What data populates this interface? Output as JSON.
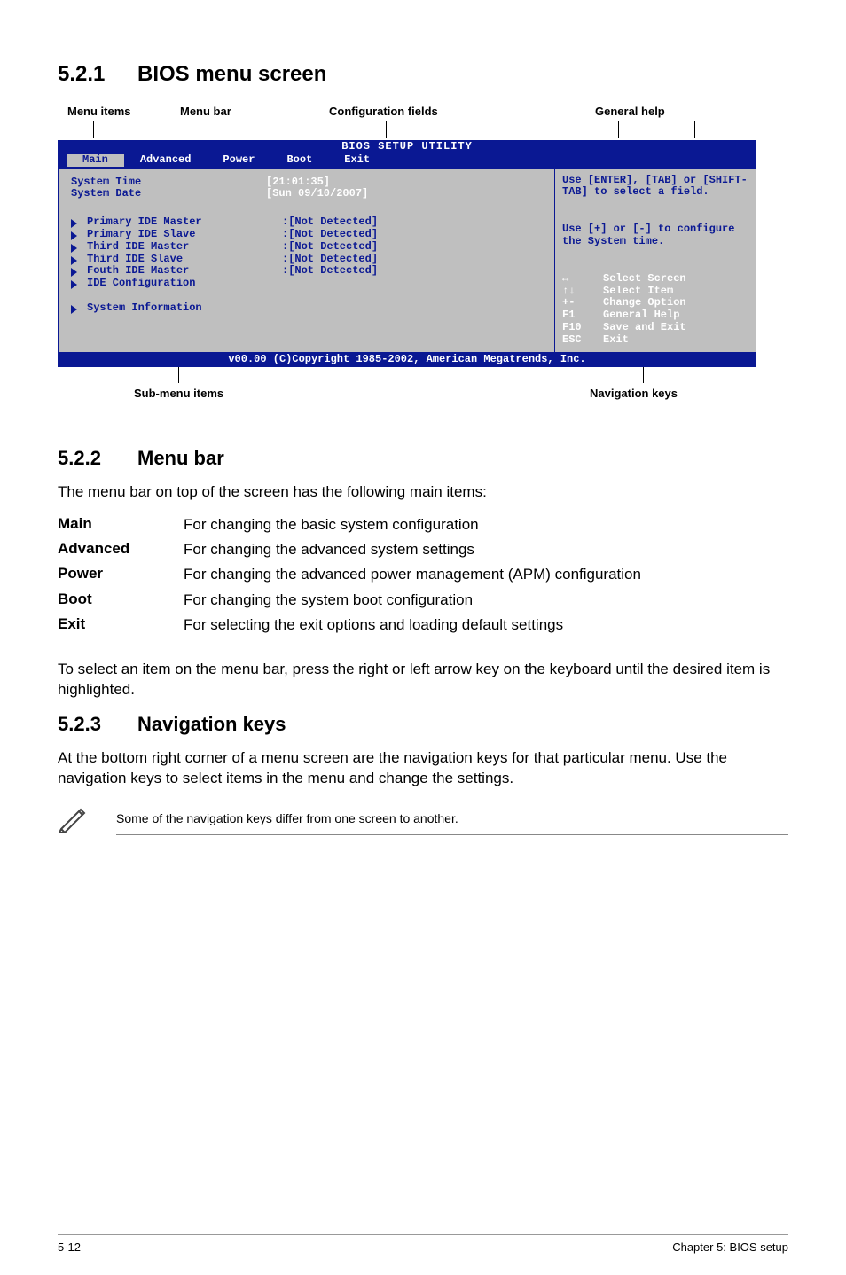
{
  "sections": {
    "s521_num": "5.2.1",
    "s521_title": "BIOS menu screen",
    "s522_num": "5.2.2",
    "s522_title": "Menu bar",
    "s522_intro": "The menu bar on top of the screen has the following main items:",
    "s523_num": "5.2.3",
    "s523_title": "Navigation keys",
    "s523_p": "At the bottom right corner of a menu screen are the navigation keys for that particular menu. Use the navigation keys to select items in the menu and change the settings.",
    "select_p": "To select an item on the menu bar, press the right or left arrow key on the keyboard until the desired item is highlighted."
  },
  "labels": {
    "menu_items": "Menu items",
    "menu_bar": "Menu bar",
    "config_fields": "Configuration fields",
    "general_help": "General help",
    "sub_menu": "Sub-menu items",
    "nav_keys": "Navigation keys"
  },
  "bios": {
    "title": "BIOS SETUP UTILITY",
    "tabs": [
      "Main",
      "Advanced",
      "Power",
      "Boot",
      "Exit"
    ],
    "rows_top": [
      {
        "k": "System Time",
        "v": "[21:01:35]"
      },
      {
        "k": "System Date",
        "v": "[Sun 09/10/2007]"
      }
    ],
    "rows_mid": [
      {
        "k": "Primary IDE Master",
        "v": ":[Not Detected]"
      },
      {
        "k": "Primary IDE Slave",
        "v": ":[Not Detected]"
      },
      {
        "k": "Third IDE Master",
        "v": ":[Not Detected]"
      },
      {
        "k": "Third IDE Slave",
        "v": ":[Not Detected]"
      },
      {
        "k": "Fouth IDE Master",
        "v": ":[Not Detected]"
      }
    ],
    "ide_conf": "IDE Configuration",
    "sysinfo": "System Information",
    "hint1": "Use [ENTER], [TAB] or [SHIFT-TAB] to select a field.",
    "hint2": "Use [+] or [-] to configure the System time.",
    "nav": [
      {
        "k": "↔",
        "v": "Select Screen"
      },
      {
        "k": "↑↓",
        "v": "Select Item"
      },
      {
        "k": "+-",
        "v": "Change Option"
      },
      {
        "k": "F1",
        "v": "General Help"
      },
      {
        "k": "F10",
        "v": "Save and Exit"
      },
      {
        "k": "ESC",
        "v": "Exit"
      }
    ],
    "foot": "v00.00 (C)Copyright 1985-2002, American Megatrends, Inc."
  },
  "defs": [
    {
      "k": "Main",
      "v": "For changing the basic system configuration"
    },
    {
      "k": "Advanced",
      "v": "For changing the advanced system settings"
    },
    {
      "k": "Power",
      "v": "For changing the advanced power management (APM) configuration"
    },
    {
      "k": "Boot",
      "v": "For changing the system boot configuration"
    },
    {
      "k": "Exit",
      "v": "For selecting the exit options and loading default settings"
    }
  ],
  "note": "Some of the navigation keys differ from one screen to another.",
  "footer": {
    "left": "5-12",
    "right": "Chapter 5: BIOS setup"
  }
}
